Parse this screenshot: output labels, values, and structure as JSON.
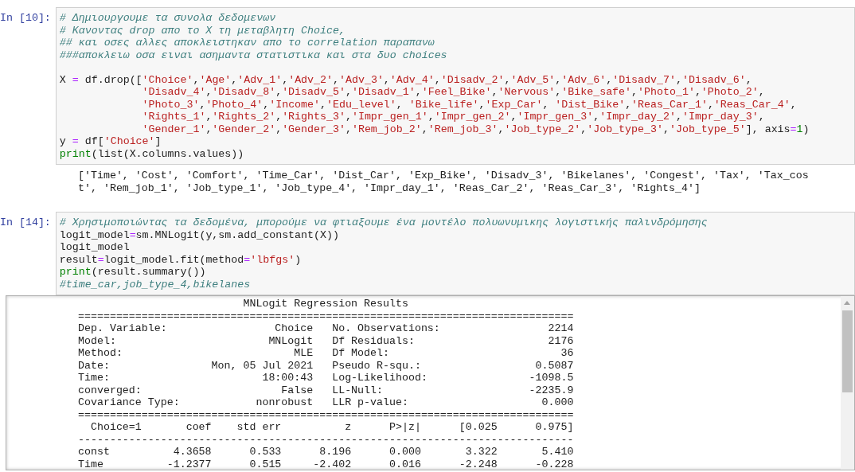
{
  "cells": [
    {
      "prompt": "In [10]:",
      "code_blocks": [
        [
          "# Δημιουργουμε τα συνολα δεδομενων",
          "# Κανοντας drop απο το X τη μεταβλητη Choice,",
          "## και οσες αλλες αποκλειστηκαν απο το correlation παραπανω",
          "###αποκλειω οσα ειναι ασημαντα στατιστικα και στα δυο choices"
        ],
        [
          "X = df.drop(['Choice','Age','Adv_1','Adv_2','Adv_3','Adv_4','Disadv_2','Adv_5','Adv_6','Disadv_7','Disadv_6',",
          "             'Disadv_4','Disadv_8','Disadv_5','Disadv_1','Feel_Bike','Nervous','Bike_safe','Photo_1','Photo_2',",
          "             'Photo_3','Photo_4','Income','Edu_level', 'Bike_life','Exp_Car', 'Dist_Bike','Reas_Car_1','Reas_Car_4',",
          "             'Rights_1','Rights_2','Rights_3','Impr_gen_1','Impr_gen_2','Impr_gen_3','Impr_day_2','Impr_day_3',",
          "             'Gender_1','Gender_2','Gender_3','Rem_job_2','Rem_job_3','Job_type_2','Job_type_3','Job_type_5'], axis=1)",
          "y = df['Choice']",
          "print(list(X.columns.values))"
        ]
      ],
      "output": {
        "kind": "text",
        "lines": [
          "['Time', 'Cost', 'Comfort', 'Time_Car', 'Dist_Car', 'Exp_Bike', 'Disadv_3', 'Bikelanes', 'Congest', 'Tax', 'Tax_cos",
          "t', 'Rem_job_1', 'Job_type_1', 'Job_type_4', 'Impr_day_1', 'Reas_Car_2', 'Reas_Car_3', 'Rights_4']"
        ]
      }
    },
    {
      "prompt": "In [14]:",
      "code_blocks": [
        [
          "# Χρησιμοποιώντας τα δεδομένα, μπορούμε να φτιαξουμε ένα μοντέλο πολυωνυμικης λογιστικής παλινδρόμησης",
          "logit_model=sm.MNLogit(y,sm.add_constant(X))",
          "logit_model",
          "result=logit_model.fit(method='lbfgs')",
          "print(result.summary())",
          "#time_car,job_type_4,bikelanes"
        ]
      ],
      "output": {
        "kind": "scrolled",
        "lines": [
          "                          MNLogit Regression Results",
          "==============================================================================",
          "Dep. Variable:                 Choice   No. Observations:                 2214",
          "Model:                        MNLogit   Df Residuals:                     2176",
          "Method:                           MLE   Df Model:                           36",
          "Date:                Mon, 05 Jul 2021   Pseudo R-squ.:                  0.5087",
          "Time:                        18:00:43   Log-Likelihood:                -1098.5",
          "converged:                      False   LL-Null:                       -2235.9",
          "Covariance Type:            nonrobust   LLR p-value:                     0.000",
          "==============================================================================",
          "  Choice=1       coef    std err          z      P>|z|      [0.025      0.975]",
          "------------------------------------------------------------------------------",
          "const          4.3658      0.533      8.196      0.000       3.322       5.410",
          "Time          -1.2377      0.515     -2.402      0.016      -2.248      -0.228"
        ]
      }
    }
  ]
}
